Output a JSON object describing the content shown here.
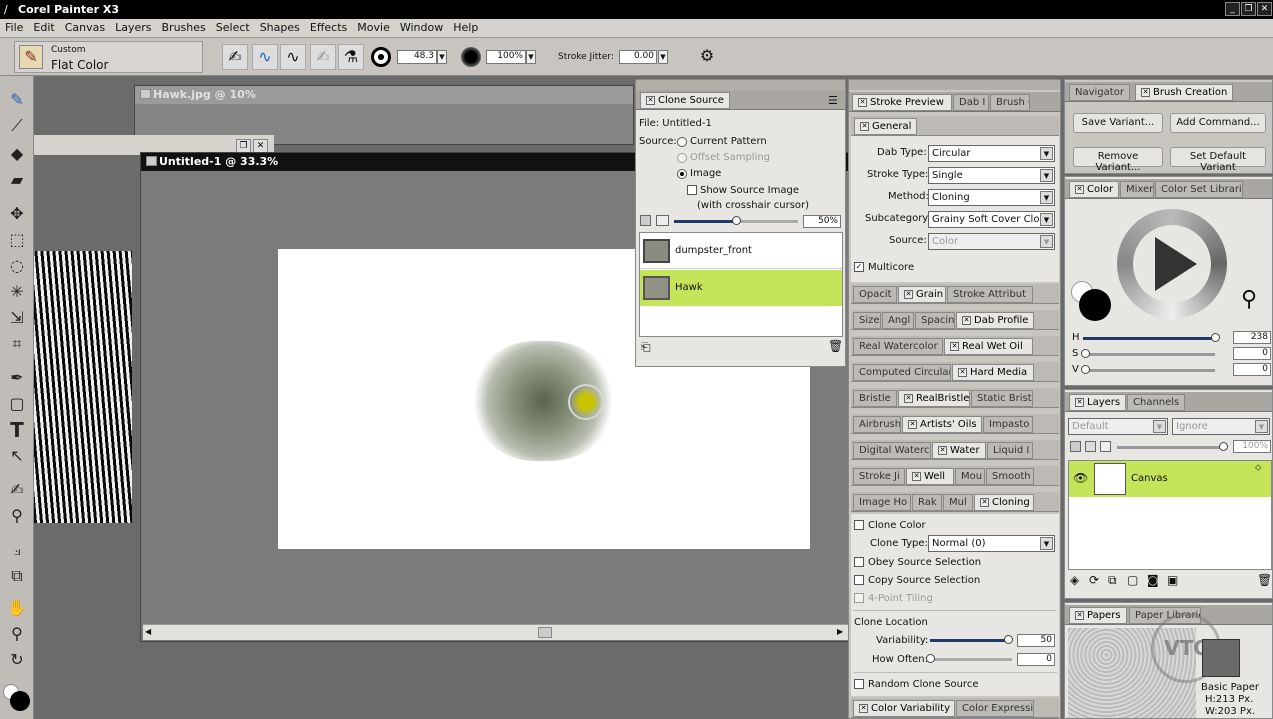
{
  "app": {
    "title": "Corel Painter X3"
  },
  "menu": [
    "File",
    "Edit",
    "Canvas",
    "Layers",
    "Brushes",
    "Select",
    "Shapes",
    "Effects",
    "Movie",
    "Window",
    "Help"
  ],
  "property_bar": {
    "category": "Custom",
    "variant": "Flat Color",
    "size": "48.3",
    "opacity": "100%",
    "jitter_label": "Stroke Jitter:",
    "jitter": "0.00"
  },
  "documents": {
    "hawk_title": "Hawk.jpg @ 10%",
    "untitled_title": "Untitled-1 @ 33.3%"
  },
  "clone_source": {
    "tab": "Clone Source",
    "file": "File: Untitled-1",
    "source_label": "Source:",
    "options": [
      "Current Pattern",
      "Offset Sampling",
      "Image"
    ],
    "show_source": "Show Source Image",
    "crosshair": "(with crosshair cursor)",
    "opacity": "50%",
    "items": [
      "dumpster_front",
      "Hawk"
    ]
  },
  "brush_controls": {
    "tabs": [
      "Stroke Preview",
      "Dab I",
      "Brush C"
    ],
    "general_tab": "General",
    "dab_type_label": "Dab Type:",
    "dab_type": "Circular",
    "stroke_type_label": "Stroke Type:",
    "stroke_type": "Single",
    "method_label": "Method:",
    "method": "Cloning",
    "subcategory_label": "Subcategory:",
    "subcategory": "Grainy Soft Cover Clo...",
    "source_label": "Source:",
    "source": "Color",
    "multicore": "Multicore",
    "rows": [
      [
        "Opacit",
        "Grain",
        "Stroke Attribut"
      ],
      [
        "Size",
        "Angl",
        "Spacin",
        "Dab Profile"
      ],
      [
        "Real Watercolor",
        "Real Wet Oil"
      ],
      [
        "Computed Circular",
        "Hard Media"
      ],
      [
        "Bristle",
        "RealBristle",
        "Static Brist"
      ],
      [
        "Airbrush",
        "Artists' Oils",
        "Impasto"
      ],
      [
        "Digital Waterc",
        "Water",
        "Liquid I"
      ],
      [
        "Stroke Ji",
        "Well",
        "Mou",
        "Smooth"
      ],
      [
        "Image Ho",
        "Rak",
        "Mul",
        "Cloning"
      ]
    ],
    "cloning": {
      "clone_color": "Clone Color",
      "clone_type_label": "Clone Type:",
      "clone_type": "Normal (0)",
      "obey": "Obey Source Selection",
      "copy": "Copy Source Selection",
      "tiling": "4-Point Tiling",
      "location": "Clone Location",
      "variability_label": "Variability:",
      "variability": "50",
      "how_often_label": "How Often:",
      "how_often": "0",
      "random": "Random Clone Source"
    },
    "bottom_tabs": [
      "Color Variability",
      "Color Expressi"
    ]
  },
  "brush_creation": {
    "tabs": [
      "Navigator",
      "Brush Creation"
    ],
    "buttons": [
      "Save Variant...",
      "Add Command...",
      "Remove Variant...",
      "Set Default Variant"
    ]
  },
  "color": {
    "tabs": [
      "Color",
      "Mixer",
      "Color Set Librarie"
    ],
    "h_label": "H",
    "h": "238",
    "s_label": "S",
    "s": "0",
    "v_label": "V",
    "v": "0"
  },
  "layers": {
    "tabs": [
      "Layers",
      "Channels"
    ],
    "composite": "Default",
    "ignore": "Ignore",
    "opacity": "100%",
    "layer": "Canvas"
  },
  "papers": {
    "tabs": [
      "Papers",
      "Paper Librarie"
    ],
    "name": "Basic Paper",
    "h": "H:213 Px.",
    "w": "W:203 Px.",
    "watermark": "VTC"
  }
}
